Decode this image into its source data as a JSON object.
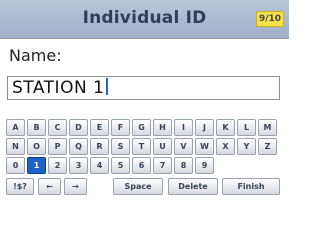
{
  "header": {
    "title": "Individual ID",
    "page_badge": "9/10"
  },
  "form": {
    "name_label": "Name:",
    "name_value": "STATION 1"
  },
  "keyboard": {
    "row1": [
      "A",
      "B",
      "C",
      "D",
      "E",
      "F",
      "G",
      "H",
      "I",
      "J",
      "K",
      "L",
      "M"
    ],
    "row2": [
      "N",
      "O",
      "P",
      "Q",
      "R",
      "S",
      "T",
      "U",
      "V",
      "W",
      "X",
      "Y",
      "Z"
    ],
    "row3": [
      "0",
      "1",
      "2",
      "3",
      "4",
      "5",
      "6",
      "7",
      "8",
      "9"
    ],
    "selected_key": "1",
    "function_keys": {
      "symbols": "!$?",
      "cursor_left": "←",
      "cursor_right": "→",
      "space": "Space",
      "delete": "Delete",
      "finish": "Finish"
    }
  },
  "colors": {
    "header": "#a8b8d0",
    "badge": "#f4e24a",
    "selected_key": "#1d63c7"
  }
}
